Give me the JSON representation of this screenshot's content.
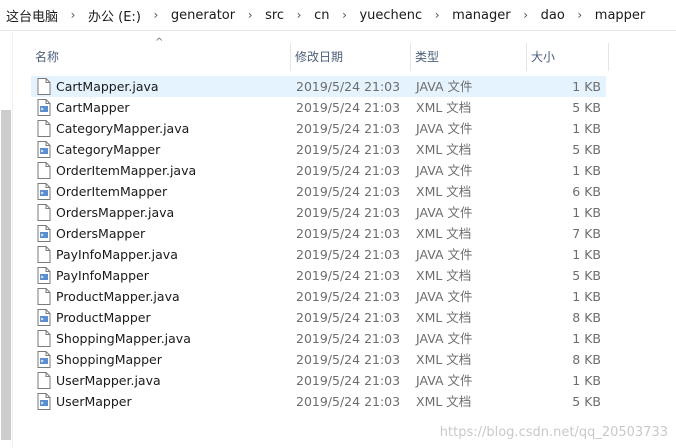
{
  "breadcrumbs": [
    "这台电脑",
    "办公 (E:)",
    "generator",
    "src",
    "cn",
    "yuechenc",
    "manager",
    "dao",
    "mapper"
  ],
  "breadcrumb_separator": "›",
  "columns": {
    "name": "名称",
    "date": "修改日期",
    "type": "类型",
    "size": "大小"
  },
  "files": [
    {
      "name": "CartMapper.java",
      "date": "2019/5/24 21:03",
      "type": "JAVA 文件",
      "size": "1 KB",
      "icon": "java-file-icon",
      "selected": true
    },
    {
      "name": "CartMapper",
      "date": "2019/5/24 21:03",
      "type": "XML 文档",
      "size": "5 KB",
      "icon": "xml-file-icon"
    },
    {
      "name": "CategoryMapper.java",
      "date": "2019/5/24 21:03",
      "type": "JAVA 文件",
      "size": "1 KB",
      "icon": "java-file-icon"
    },
    {
      "name": "CategoryMapper",
      "date": "2019/5/24 21:03",
      "type": "XML 文档",
      "size": "5 KB",
      "icon": "xml-file-icon"
    },
    {
      "name": "OrderItemMapper.java",
      "date": "2019/5/24 21:03",
      "type": "JAVA 文件",
      "size": "1 KB",
      "icon": "java-file-icon"
    },
    {
      "name": "OrderItemMapper",
      "date": "2019/5/24 21:03",
      "type": "XML 文档",
      "size": "6 KB",
      "icon": "xml-file-icon"
    },
    {
      "name": "OrdersMapper.java",
      "date": "2019/5/24 21:03",
      "type": "JAVA 文件",
      "size": "1 KB",
      "icon": "java-file-icon"
    },
    {
      "name": "OrdersMapper",
      "date": "2019/5/24 21:03",
      "type": "XML 文档",
      "size": "7 KB",
      "icon": "xml-file-icon"
    },
    {
      "name": "PayInfoMapper.java",
      "date": "2019/5/24 21:03",
      "type": "JAVA 文件",
      "size": "1 KB",
      "icon": "java-file-icon"
    },
    {
      "name": "PayInfoMapper",
      "date": "2019/5/24 21:03",
      "type": "XML 文档",
      "size": "5 KB",
      "icon": "xml-file-icon"
    },
    {
      "name": "ProductMapper.java",
      "date": "2019/5/24 21:03",
      "type": "JAVA 文件",
      "size": "1 KB",
      "icon": "java-file-icon"
    },
    {
      "name": "ProductMapper",
      "date": "2019/5/24 21:03",
      "type": "XML 文档",
      "size": "8 KB",
      "icon": "xml-file-icon"
    },
    {
      "name": "ShoppingMapper.java",
      "date": "2019/5/24 21:03",
      "type": "JAVA 文件",
      "size": "1 KB",
      "icon": "java-file-icon"
    },
    {
      "name": "ShoppingMapper",
      "date": "2019/5/24 21:03",
      "type": "XML 文档",
      "size": "8 KB",
      "icon": "xml-file-icon"
    },
    {
      "name": "UserMapper.java",
      "date": "2019/5/24 21:03",
      "type": "JAVA 文件",
      "size": "1 KB",
      "icon": "java-file-icon"
    },
    {
      "name": "UserMapper",
      "date": "2019/5/24 21:03",
      "type": "XML 文档",
      "size": "5 KB",
      "icon": "xml-file-icon"
    }
  ],
  "watermark": "https://blog.csdn.net/qq_20503733",
  "colors": {
    "selected_row": "#e5f3ff",
    "header_text": "#4c607a",
    "meta_text": "#6d6d6d"
  }
}
